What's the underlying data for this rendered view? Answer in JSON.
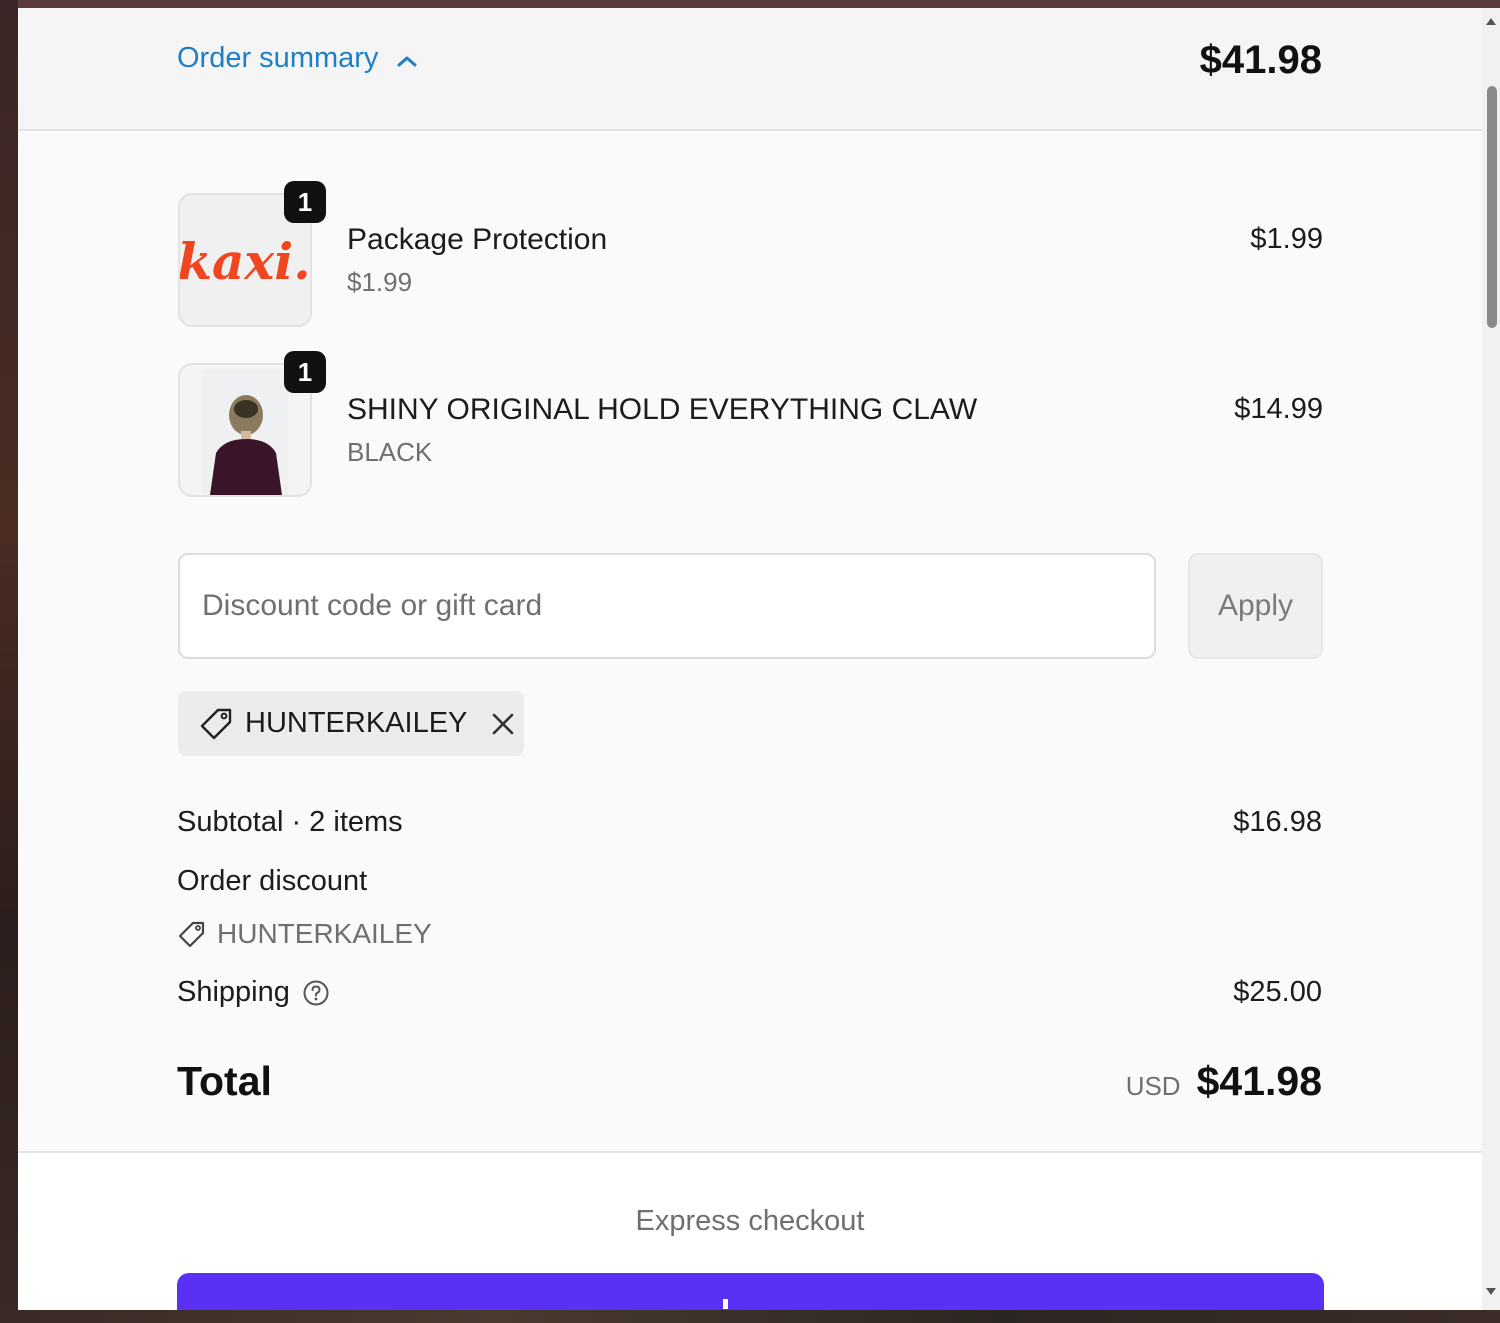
{
  "header": {
    "toggle_label": "Order summary",
    "total": "$41.98"
  },
  "line_items": [
    {
      "title": "Package Protection",
      "subtitle": "$1.99",
      "price": "$1.99",
      "quantity": "1",
      "thumbnail": "kaxi logo",
      "thumbnail_text": "kaxi."
    },
    {
      "title": "SHINY ORIGINAL HOLD EVERYTHING CLAW",
      "subtitle": "BLACK",
      "price": "$14.99",
      "quantity": "1",
      "thumbnail": "person wearing hair claw"
    }
  ],
  "discount": {
    "placeholder": "Discount code or gift card",
    "value": "",
    "apply_label": "Apply",
    "applied_code": "HUNTERKAILEY"
  },
  "totals": {
    "subtotal_label": "Subtotal · 2 items",
    "subtotal_value": "$16.98",
    "order_discount_label": "Order discount",
    "order_discount_code": "HUNTERKAILEY",
    "shipping_label": "Shipping",
    "shipping_value": "$25.00",
    "total_label": "Total",
    "currency": "USD",
    "total_value": "$41.98"
  },
  "express": {
    "title": "Express checkout"
  },
  "colors": {
    "link_blue": "#1f7fc4",
    "shoppay_purple": "#5a31f4",
    "logo_red": "#f0451f"
  },
  "icons": [
    "chevron-up-icon",
    "tag-icon",
    "close-icon",
    "help-icon"
  ]
}
